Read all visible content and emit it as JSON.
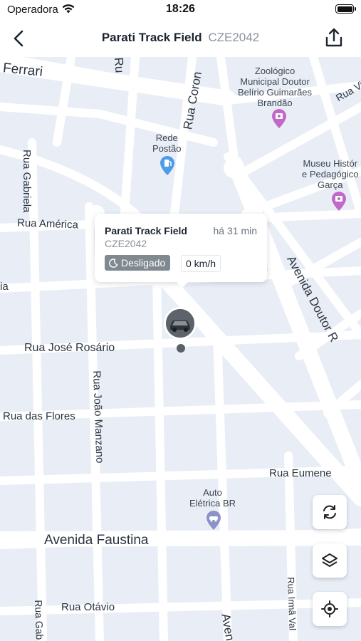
{
  "status_bar": {
    "carrier": "Operadora",
    "time": "18:26"
  },
  "nav": {
    "title": "Parati Track Field",
    "plate": "CZE2042"
  },
  "map": {
    "streets": {
      "ferrari": "Ferrari",
      "rua_r": "Ru",
      "rua_coron": "Rua Coron",
      "rua_v": "Rua Vi",
      "rua_gabriela": "Rua Gabriela",
      "rua_america": "Rua América",
      "avenida_doutor": "Avenida Doutor R",
      "ia": "ia",
      "rua_jose_rosario": "Rua José Rosário",
      "rua_joao_manzano": "Rua João Manzano",
      "rua_das_flores": "Rua das Flores",
      "rua_eumene": "Rua Eumene",
      "avenida_faustina": "Avenida Faustina",
      "rua_otavio": "Rua Otávio",
      "rua_gab_bottom": "Rua Gab",
      "rua_irma_val": "Rua Irmã Val",
      "ave_bottom": "Aven"
    },
    "pois": {
      "zoo": "Zoológico\nMunicipal Doutor\nBelírio Guimarães\nBrandão",
      "rede_postao": "Rede\nPostão",
      "museu": "Museu Histór\ne Pedagógico\nGarça",
      "auto_eletrica": "Auto\nElétrica BR"
    }
  },
  "popup": {
    "name": "Parati Track Field",
    "time_ago": "há 31 min",
    "plate": "CZE2042",
    "status": "Desligado",
    "speed": "0 km/h"
  },
  "icons": {
    "back": "chevron-left-icon",
    "share": "share-icon",
    "refresh": "refresh-icon",
    "layers": "layers-icon",
    "locate": "locate-icon",
    "moon": "moon-icon"
  },
  "colors": {
    "road": "#ffffff",
    "map_bg": "#e9eef6",
    "poi_pink": "#c069c8",
    "poi_blue": "#4e9be6",
    "badge": "#818990"
  }
}
